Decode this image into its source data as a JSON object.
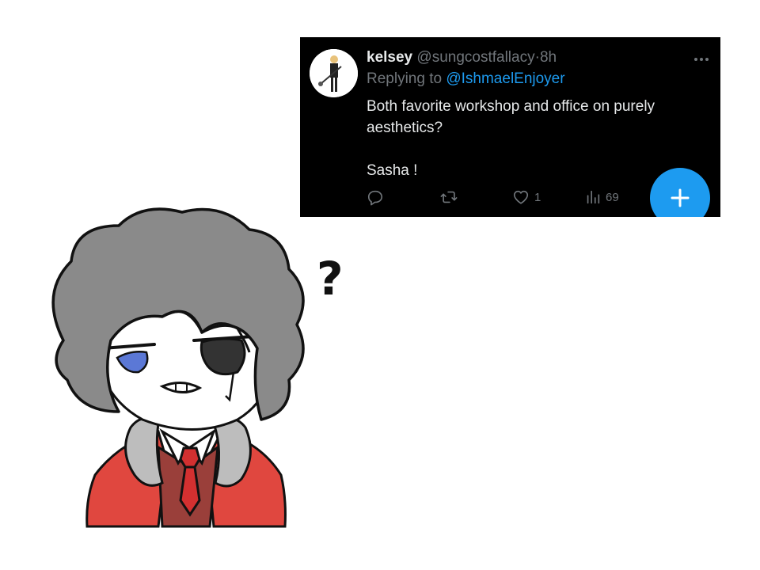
{
  "tweet": {
    "author": {
      "display_name": "kelsey",
      "handle": "@sungcostfallacy",
      "separator": "·",
      "time": "8h"
    },
    "reply": {
      "prefix": "Replying to ",
      "mention": "@IshmaelEnjoyer"
    },
    "text_lines": [
      "Both favorite workshop and office on purely",
      "aesthetics?",
      "Sasha !"
    ],
    "actions": {
      "reply_count": "",
      "retweet_count": "",
      "like_count": "1",
      "views_count": "69"
    },
    "icons": {
      "avatar": "avatar-image",
      "more": "more-options-icon",
      "reply": "reply-icon",
      "retweet": "retweet-icon",
      "like": "heart-icon",
      "views": "views-chart-icon",
      "compose": "plus-icon"
    },
    "colors": {
      "card_background": "#000000",
      "accent": "#1d9bf0",
      "muted": "#71767b",
      "text": "#e7e9ea"
    }
  },
  "drawing": {
    "question_mark": "?",
    "colors": {
      "hair": "#8a8a8a",
      "eye": "#5b78d6",
      "jacket": "#e0473f",
      "tie": "#d33030",
      "vest": "#9a3f3a",
      "fur": "#bdbdbd"
    }
  }
}
